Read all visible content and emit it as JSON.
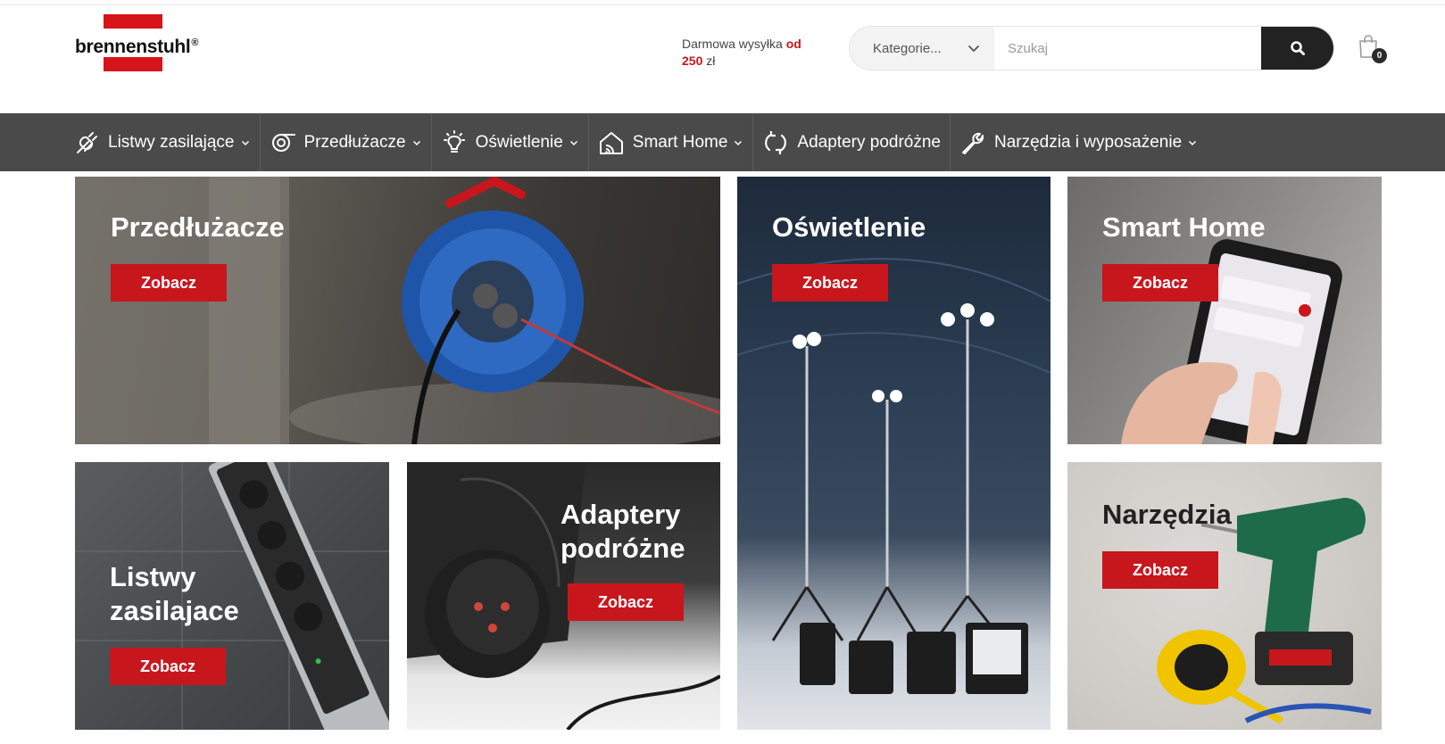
{
  "brand": {
    "name": "brennenstuhl",
    "reg": "®",
    "red": "#d7141a"
  },
  "header": {
    "shipping_text": "Darmowa wysyłka",
    "shipping_accent_word": "od",
    "shipping_amount": "250",
    "shipping_currency": "zł"
  },
  "search": {
    "category_label": "Kategorie...",
    "placeholder": "Szukaj",
    "button_icon": "search-icon"
  },
  "cart": {
    "count": "0",
    "icon": "shopping-bag-icon"
  },
  "nav": {
    "items": [
      {
        "label": "Listwy zasilające",
        "icon": "plug-icon",
        "dropdown": true
      },
      {
        "label": "Przedłużacze",
        "icon": "cable-reel-icon",
        "dropdown": true
      },
      {
        "label": "Oświetlenie",
        "icon": "lightbulb-icon",
        "dropdown": true
      },
      {
        "label": "Smart Home",
        "icon": "smart-home-icon",
        "dropdown": true
      },
      {
        "label": "Adaptery podróżne",
        "icon": "adapter-cycle-icon",
        "dropdown": false
      },
      {
        "label": "Narzędzia i wyposażenie",
        "icon": "wrench-icon",
        "dropdown": true
      }
    ],
    "bg_color": "#4a4a4a"
  },
  "tiles": {
    "extensions": {
      "title": "Przedłużacze",
      "cta": "Zobacz"
    },
    "lighting": {
      "title": "Oświetlenie",
      "cta": "Zobacz"
    },
    "smart_home": {
      "title": "Smart Home",
      "cta": "Zobacz"
    },
    "strips": {
      "title_line1": "Listwy",
      "title_line2": "zasilajace",
      "cta": "Zobacz"
    },
    "adapters": {
      "title_line1": "Adaptery",
      "title_line2": "podróżne",
      "cta": "Zobacz"
    },
    "tools": {
      "title": "Narzędzia",
      "cta": "Zobacz"
    }
  },
  "cta_color": "#c8161d"
}
